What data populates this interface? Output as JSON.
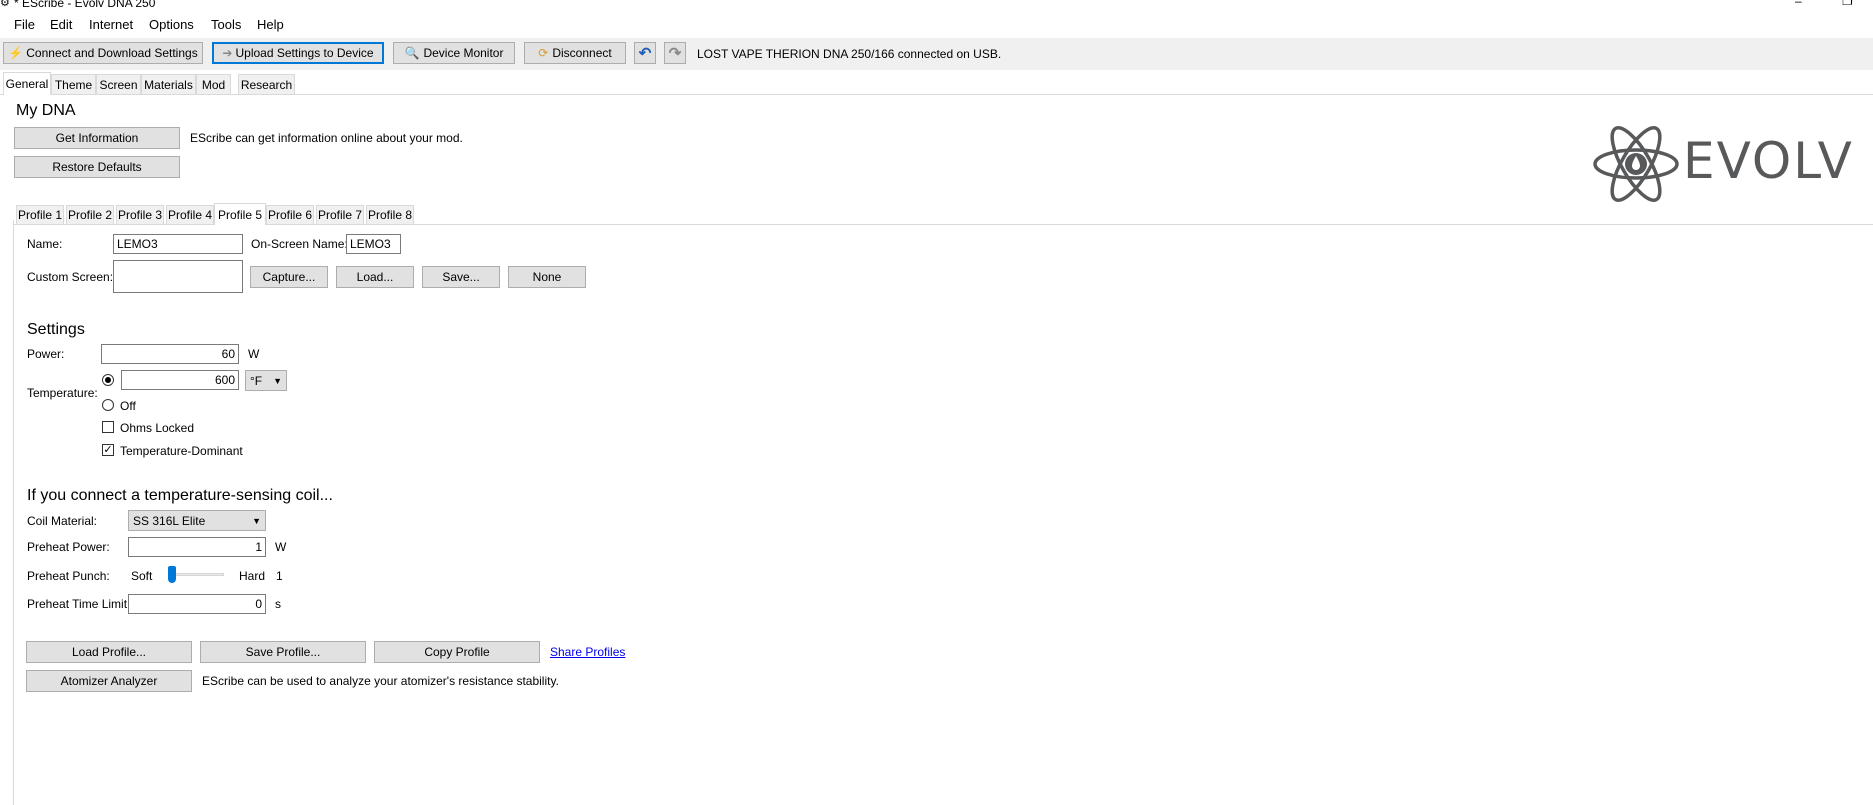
{
  "window": {
    "title": "* EScribe - Evolv DNA 250"
  },
  "menu": [
    "File",
    "Edit",
    "Internet",
    "Options",
    "Tools",
    "Help"
  ],
  "toolbar": {
    "connect_label": "Connect and Download Settings",
    "upload_label": "Upload Settings to Device",
    "monitor_label": "Device Monitor",
    "disconnect_label": "Disconnect",
    "status": "LOST VAPE THERION DNA 250/166 connected on USB."
  },
  "main_tabs": [
    "General",
    "Theme",
    "Screen",
    "Materials",
    "Mod",
    "Research"
  ],
  "my_dna": {
    "title": "My DNA",
    "get_info_label": "Get Information",
    "get_info_desc": "EScribe can get information online about your mod.",
    "restore_label": "Restore Defaults"
  },
  "logo": {
    "text": "EVOLV"
  },
  "profile_tabs": [
    "Profile 1",
    "Profile 2",
    "Profile 3",
    "Profile 4",
    "Profile 5",
    "Profile 6",
    "Profile 7",
    "Profile 8"
  ],
  "profile": {
    "name_label": "Name:",
    "name_value": "LEMO3",
    "onscreen_label": "On-Screen Name:",
    "onscreen_value": "LEMO3",
    "custom_screen_label": "Custom Screen:",
    "capture_label": "Capture...",
    "load_label": "Load...",
    "save_label": "Save...",
    "none_label": "None"
  },
  "settings": {
    "title": "Settings",
    "power_label": "Power:",
    "power_value": "60",
    "power_unit": "W",
    "temp_label": "Temperature:",
    "temp_value": "600",
    "temp_unit": "°F",
    "off_label": "Off",
    "ohms_locked_label": "Ohms Locked",
    "temp_dominant_label": "Temperature-Dominant"
  },
  "coil": {
    "title": "If you connect a temperature-sensing coil...",
    "material_label": "Coil Material:",
    "material_value": "SS 316L Elite",
    "preheat_power_label": "Preheat Power:",
    "preheat_power_value": "1",
    "preheat_power_unit": "W",
    "punch_label": "Preheat Punch:",
    "punch_soft": "Soft",
    "punch_hard": "Hard",
    "punch_value": "1",
    "time_label": "Preheat Time Limit:",
    "time_value": "0",
    "time_unit": "s"
  },
  "bottom": {
    "load_profile_label": "Load Profile...",
    "save_profile_label": "Save Profile...",
    "copy_profile_label": "Copy Profile",
    "share_label": "Share Profiles",
    "atomizer_label": "Atomizer Analyzer",
    "atomizer_desc": "EScribe can be used to analyze your atomizer's resistance stability."
  },
  "colors": {
    "accent": "#0078d7",
    "link": "#0000ee",
    "logo": "#58595b"
  }
}
